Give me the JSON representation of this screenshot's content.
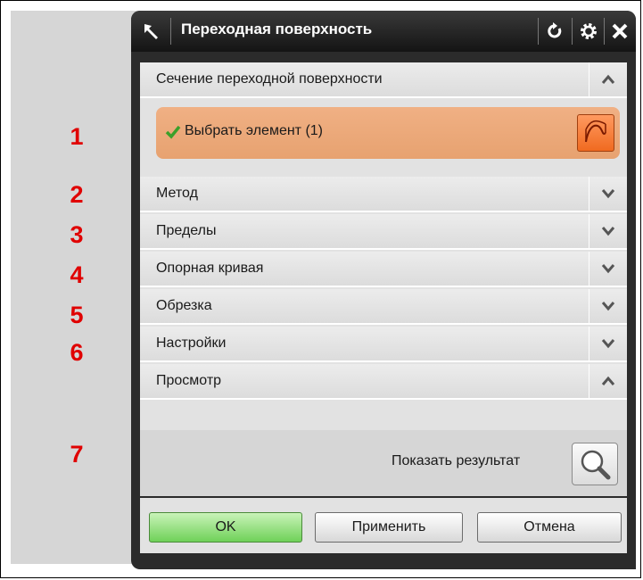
{
  "dialog": {
    "title": "Переходная поверхность"
  },
  "sections": [
    {
      "label": "Сечение переходной поверхности",
      "state": "expanded"
    },
    {
      "label": "Метод",
      "state": "collapsed"
    },
    {
      "label": "Пределы",
      "state": "collapsed"
    },
    {
      "label": "Опорная кривая",
      "state": "collapsed"
    },
    {
      "label": "Обрезка",
      "state": "collapsed"
    },
    {
      "label": "Настройки",
      "state": "collapsed"
    },
    {
      "label": "Просмотр",
      "state": "expanded"
    }
  ],
  "select_element": {
    "label": "Выбрать элемент (1)"
  },
  "preview": {
    "show_result_label": "Показать результат"
  },
  "buttons": {
    "ok": "OK",
    "apply": "Применить",
    "cancel": "Отмена"
  },
  "annotations": [
    "1",
    "2",
    "3",
    "4",
    "5",
    "6",
    "7"
  ],
  "colors": {
    "annotation": "#e00000",
    "title_bar": "#1f1f1f",
    "selection_row": "#eba676",
    "ok_button": "#7ed866"
  },
  "icons": {
    "pin": "pin-arrow-icon",
    "reset": "reset-icon",
    "settings": "gear-icon",
    "close": "close-icon",
    "check": "check-icon",
    "curve": "section-curve-icon",
    "preview": "magnifier-icon",
    "expand": "chevron-down-icon",
    "collapse": "chevron-up-icon"
  }
}
